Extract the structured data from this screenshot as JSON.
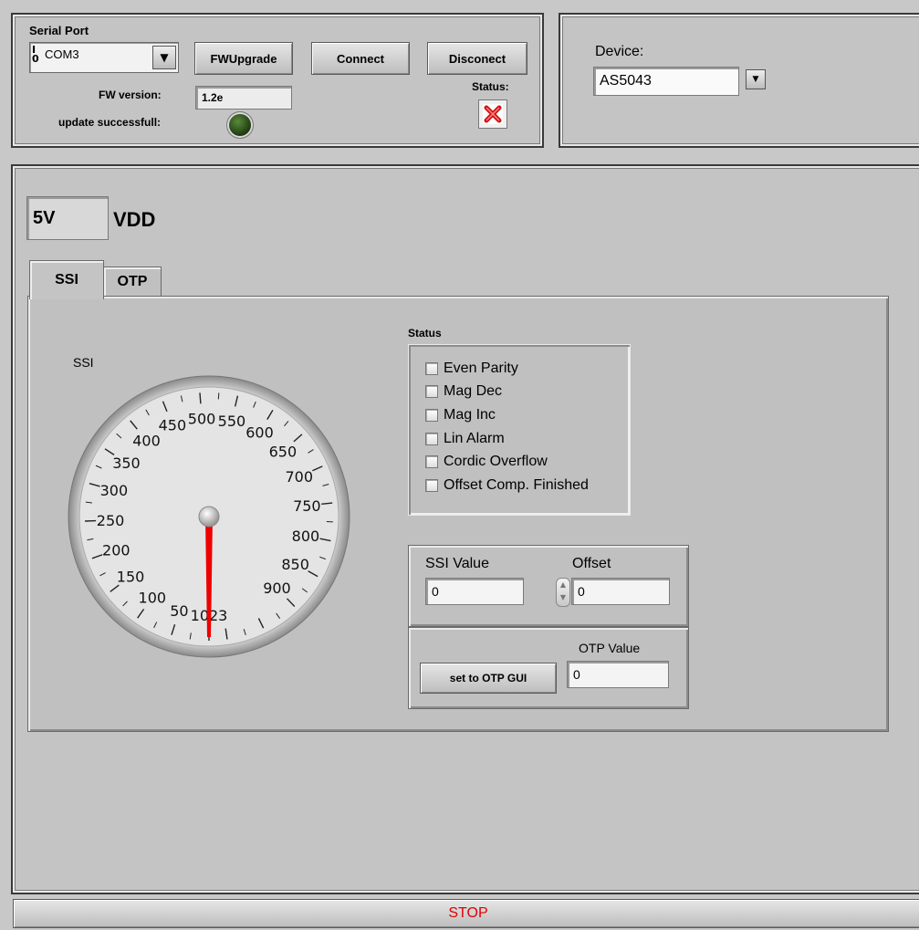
{
  "serial_panel": {
    "title": "Serial Port",
    "port_icon": "io-port-icon",
    "port_value": "COM3",
    "fw_upgrade_label": "FWUpgrade",
    "connect_label": "Connect",
    "disconnect_label": "Disconect",
    "fw_version_label": "FW version:",
    "fw_version_value": "1.2e",
    "update_label": "update successfull:",
    "status_label": "Status:",
    "status_icon": "red-x-icon"
  },
  "device_panel": {
    "label": "Device:",
    "value": "AS5043"
  },
  "vdd": {
    "value": "5V",
    "label": "VDD"
  },
  "tabs": [
    {
      "label": "SSI"
    },
    {
      "label": "OTP"
    }
  ],
  "gauge": {
    "label": "SSI",
    "ticks": [
      "50",
      "100",
      "150",
      "200",
      "250",
      "300",
      "350",
      "400",
      "450",
      "500",
      "550",
      "600",
      "650",
      "700",
      "750",
      "800",
      "850",
      "900",
      "1023"
    ],
    "value": 0,
    "max": 1023
  },
  "status_group": {
    "title": "Status",
    "items": [
      {
        "label": "Even Parity"
      },
      {
        "label": "Mag Dec"
      },
      {
        "label": "Mag Inc"
      },
      {
        "label": "Lin Alarm"
      },
      {
        "label": "Cordic Overflow"
      },
      {
        "label": "Offset Comp. Finished"
      }
    ]
  },
  "ssi_box": {
    "ssi_value_label": "SSI Value",
    "ssi_value": "0",
    "offset_label": "Offset",
    "offset_value": "0"
  },
  "otp_box": {
    "set_button_label": "set to OTP GUI",
    "otp_value_label": "OTP Value",
    "otp_value": "0"
  },
  "stop_label": "STOP",
  "colors": {
    "stop_text": "#e00000",
    "needle": "#ee0000",
    "led_off": "#2f4f1f"
  }
}
